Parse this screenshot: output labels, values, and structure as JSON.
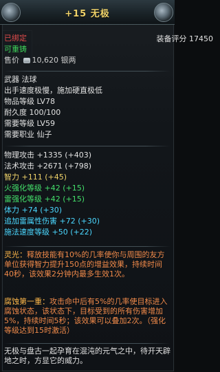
{
  "item": {
    "title": "+15 无极",
    "status_bound": "已绑定",
    "status_reforge": "可重铸",
    "price_label": "售价",
    "price_value": "10,620",
    "price_unit": "银两",
    "score_label": "装备评分",
    "score_value": "17450"
  },
  "info": {
    "weapon_type": "武器 法球",
    "speed": "出手速度极慢，施加硬直极低",
    "item_level": "物品等级 LV78",
    "durability": "耐久度 100/100",
    "req_level": "需要等级 LV59",
    "req_job": "需要职业 仙子"
  },
  "stats": {
    "phys_attack": "物理攻击 +1335 (+403)",
    "mag_attack": "法术攻击 +2671 (+798)",
    "wisdom": "智力 +111 (+45)",
    "fire_enhance": "火强化等级 +42 (+15)",
    "thunder_enhance": "雷强化等级 +42 (+15)",
    "stamina": "体力 +74 (+30)",
    "thunder_damage": "追加雷属性伤害 +72 (+30)",
    "cast_speed": "施法速度等级 +50 (+22)"
  },
  "effects": {
    "lingguang_title": "灵光：",
    "lingguang_text": "释放技能有10%的几率使你与周围的友方单位获得智力提升150点的增益效果，持续时间40秒，该效果2分钟内最多生效1次。",
    "fushi_title": "腐蚀第一重：",
    "fushi_text": "攻击命中后有5%的几率使目标进入腐蚀状态，该状态下，目标受到的所有伤害增加5%，持续时间5秒；该效果可以叠加2次。（强化等级达到15时激活）"
  },
  "lore": "无极与盘古一起孕育在混沌的元气之中，待开天辟地之时，方显它的威力。",
  "colors": {
    "gold": "#f0d36a",
    "red": "#e14b4b",
    "green": "#3fd35a",
    "cyan": "#4bd7ff",
    "orange": "#ff6a3a"
  }
}
